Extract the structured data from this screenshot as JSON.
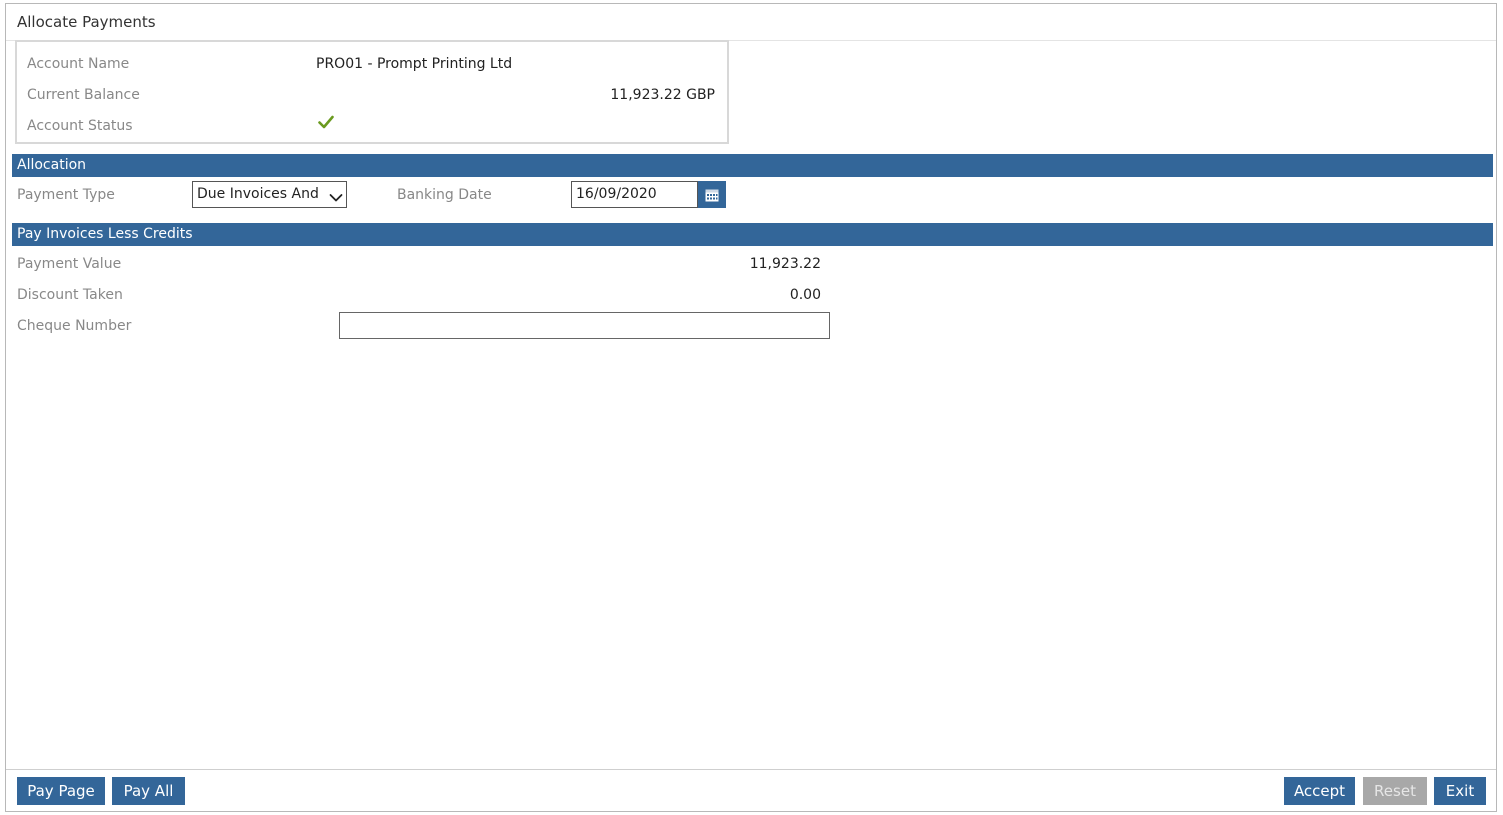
{
  "window": {
    "title": "Allocate Payments"
  },
  "account": {
    "name_label": "Account Name",
    "name_value": "PRO01 - Prompt Printing Ltd",
    "balance_label": "Current Balance",
    "balance_value": "11,923.22 GBP",
    "status_label": "Account Status",
    "status_icon": "checkmark-icon",
    "status_color": "#6a9a1f"
  },
  "allocation": {
    "section_title": "Allocation",
    "payment_type_label": "Payment Type",
    "payment_type_value": "Due Invoices And Credits",
    "banking_date_label": "Banking Date",
    "banking_date_value": "16/09/2020",
    "calendar_icon": "calendar-icon"
  },
  "pay_invoices": {
    "section_title": "Pay Invoices Less Credits",
    "payment_value_label": "Payment Value",
    "payment_value": "11,923.22",
    "discount_label": "Discount Taken",
    "discount_value": "0.00",
    "cheque_label": "Cheque Number",
    "cheque_value": ""
  },
  "footer": {
    "pay_page": "Pay Page",
    "pay_all": "Pay All",
    "accept": "Accept",
    "reset": "Reset",
    "exit": "Exit"
  },
  "colors": {
    "accent": "#336699",
    "disabled": "#a8a8a8"
  }
}
